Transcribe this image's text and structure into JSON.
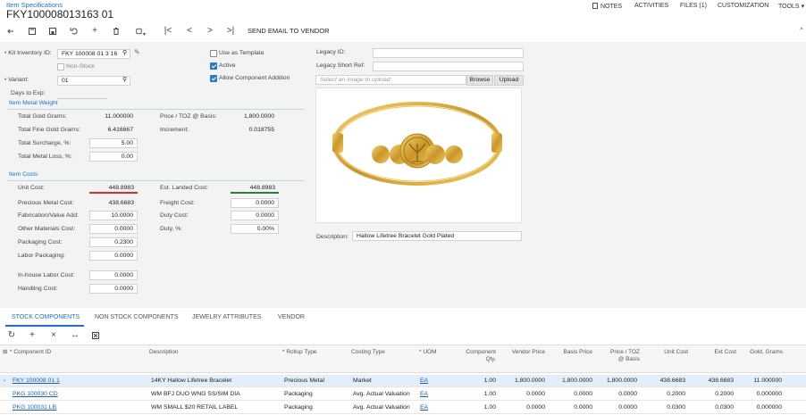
{
  "breadcrumb": "Item Specifications",
  "title": "FKY100008013163 01",
  "topmenu": {
    "notes": "NOTES",
    "activities": "ACTIVITIES",
    "files": "FILES (1)",
    "customization": "CUSTOMIZATION",
    "tools": "TOOLS"
  },
  "toolbar": {
    "send_email": "SEND EMAIL TO VENDOR"
  },
  "form": {
    "kit_label": "Kit Inventory ID:",
    "kit_value": "FKY 100008 01 3 16",
    "nonstock_label": "Non-Stock",
    "variant_label": "Variant:",
    "variant_value": "01",
    "days_label": "Days to Exp:",
    "use_template_label": "Use as Template",
    "active_label": "Active",
    "allow_addition_label": "Allow Component Addition",
    "legacy_id_label": "Legacy ID:",
    "legacy_short_label": "Legacy Short Ref:",
    "image_placeholder": "Select an image to upload",
    "browse": "Browse",
    "upload": "Upload",
    "description_label": "Description:",
    "description_value": "Hallow Lifetree Bracelet Gold Plated"
  },
  "metal_weight": {
    "section": "Item Metal Weight",
    "total_gold_label": "Total Gold Grams:",
    "total_gold": "11.000000",
    "fine_gold_label": "Total Fine Gold Grams:",
    "fine_gold": "6.416667",
    "surcharge_label": "Total Surcharge, %:",
    "surcharge": "5.00",
    "metal_loss_label": "Total Metal Loss, %:",
    "metal_loss": "0.00",
    "price_toz_label": "Price / TOZ @ Basis:",
    "price_toz": "1,800.0000",
    "increment_label": "Increment:",
    "increment": "0.018755"
  },
  "costs": {
    "section": "Item Costs",
    "unit_cost_label": "Unit Cost:",
    "unit_cost": "448.8983",
    "precious_label": "Precious Metal Cost:",
    "precious": "438.6683",
    "fabrication_label": "Fabrication/Value Add:",
    "fabrication": "10.0000",
    "other_label": "Other Materials Cost:",
    "other": "0.0000",
    "packaging_label": "Packaging Cost:",
    "packaging": "0.2300",
    "labor_pack_label": "Labor Packaging:",
    "labor_pack": "0.0000",
    "inhouse_label": "In-house Labor Cost:",
    "inhouse": "0.0000",
    "handling_label": "Handling Cost:",
    "handling": "0.0000",
    "landed_label": "Est. Landed Cost:",
    "landed": "448.8983",
    "freight_label": "Freight Cost:",
    "freight": "0.0000",
    "duty_cost_label": "Duty Cost:",
    "duty_cost": "0.0000",
    "duty_pct_label": "Duty, %:",
    "duty_pct": "0.00%"
  },
  "tabs": [
    "STOCK COMPONENTS",
    "NON STOCK COMPONENTS",
    "JEWELRY ATTRIBUTES",
    "VENDOR"
  ],
  "grid": {
    "headers": {
      "component": "* Component ID",
      "description": "Description",
      "rollup": "* Rollup Type",
      "costing": "Costing Type",
      "uom": "* UOM",
      "comp_qty1": "Component",
      "comp_qty2": "Qty.",
      "vendor_price": "Vendor Price",
      "basis_price": "Basis Price",
      "price_toz1": "Price / TOZ",
      "price_toz2": "@ Basis",
      "unit_cost": "Unit Cost",
      "ext_cost": "Ext Cost",
      "gold_grams": "Gold, Grams"
    },
    "rows": [
      {
        "id": "FKY 100008 01 1",
        "desc": "14KY Hallow Lifetree Bracelet",
        "rollup": "Precious Metal",
        "costing": "Market",
        "uom": "EA",
        "qty": "1.00",
        "vendor": "1,800.0000",
        "basis": "1,800.0000",
        "toz": "1,800.0000",
        "unit": "438.6683",
        "ext": "438.6683",
        "gold": "11.000000"
      },
      {
        "id": "PKG 100030 CD",
        "desc": "WM BFJ DUO WNG SS/SIM DIA",
        "rollup": "Packaging",
        "costing": "Avg. Actual Valuation",
        "uom": "EA",
        "qty": "1.00",
        "vendor": "0.0000",
        "basis": "0.0000",
        "toz": "0.0000",
        "unit": "0.2000",
        "ext": "0.2000",
        "gold": "0.000000"
      },
      {
        "id": "PKG 100031 LB",
        "desc": "WM SMALL $20 RETAIL LABEL",
        "rollup": "Packaging",
        "costing": "Avg. Actual Valuation",
        "uom": "EA",
        "qty": "1.00",
        "vendor": "0.0000",
        "basis": "0.0000",
        "toz": "0.0000",
        "unit": "0.0300",
        "ext": "0.0300",
        "gold": "0.000000"
      }
    ]
  },
  "colors": {
    "accent": "#1a73c8",
    "red_underline": "#d9302c",
    "green_underline": "#2e7d32"
  }
}
